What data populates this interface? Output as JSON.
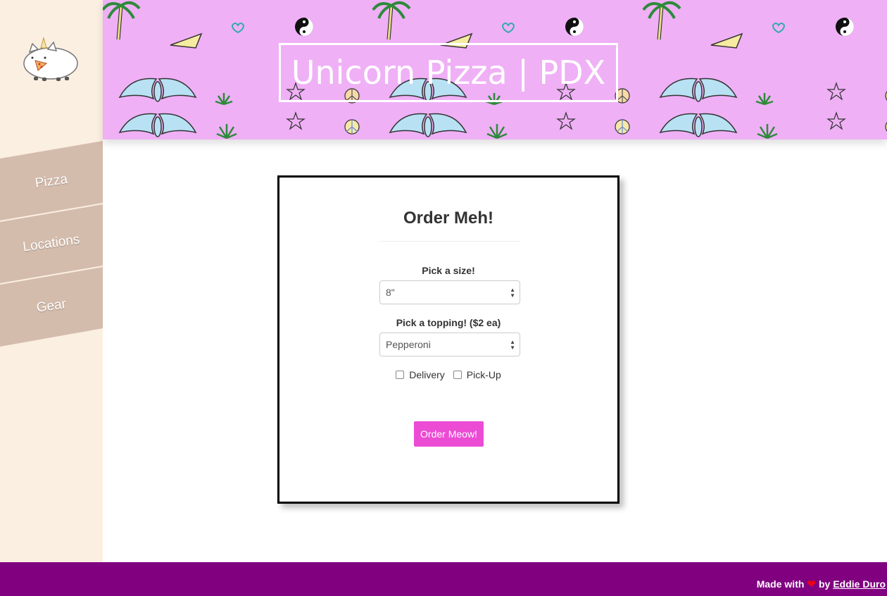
{
  "header": {
    "title": "Unicorn Pizza | PDX"
  },
  "sidebar": {
    "logo_icon": "pusheen-unicorn-cat-icon",
    "items": [
      {
        "label": "Pizza"
      },
      {
        "label": "Locations"
      },
      {
        "label": "Gear"
      }
    ]
  },
  "order_form": {
    "title": "Order Meh!",
    "size": {
      "label": "Pick a size!",
      "selected": "8\""
    },
    "topping": {
      "label": "Pick a topping! ($2 ea)",
      "selected": "Pepperoni"
    },
    "options": [
      {
        "label": "Delivery",
        "checked": false
      },
      {
        "label": "Pick-Up",
        "checked": false
      }
    ],
    "submit_label": "Order Meow!"
  },
  "footer": {
    "made_with": "Made with",
    "heart_icon": "heart-icon",
    "by": "by",
    "author": "Eddie Duro"
  },
  "colors": {
    "sidebar_bg": "#fbefe2",
    "nav_band": "#d4bcac",
    "banner_bg": "#efb0f6",
    "button_bg": "#ec4bd4",
    "footer_bg": "#800080"
  }
}
